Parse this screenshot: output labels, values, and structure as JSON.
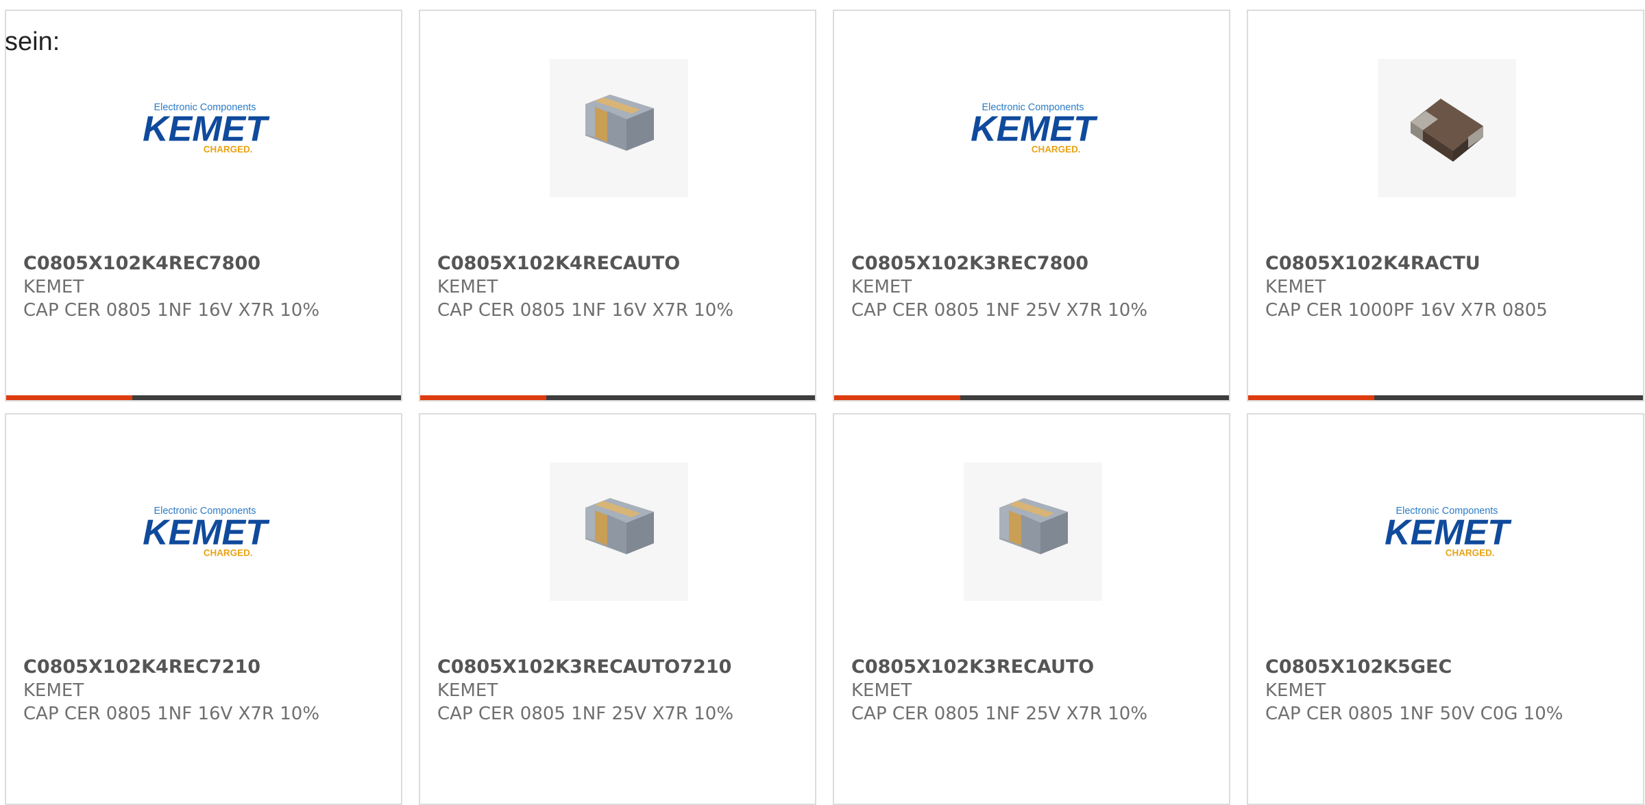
{
  "intro": "sein:",
  "brand": {
    "tagline": "Electronic Components",
    "name": "KEMET",
    "slogan": "CHARGED."
  },
  "colors": {
    "accent": "#dd3c0f",
    "bar_track": "#3d3d3d",
    "brand_blue": "#0f4a9c",
    "brand_gold": "#e8a317"
  },
  "cards": [
    {
      "part": "C0805X102K4REC7800",
      "mfr": "KEMET",
      "desc": "CAP CER 0805 1NF 16V X7R 10%",
      "image": "kemet-logo",
      "progress": 0.32
    },
    {
      "part": "C0805X102K4RECAUTO",
      "mfr": "KEMET",
      "desc": "CAP CER 0805 1NF 16V X7R 10%",
      "image": "capacitor-chip-gray",
      "progress": 0.32
    },
    {
      "part": "C0805X102K3REC7800",
      "mfr": "KEMET",
      "desc": "CAP CER 0805 1NF 25V X7R 10%",
      "image": "kemet-logo",
      "progress": 0.32
    },
    {
      "part": "C0805X102K4RACTU",
      "mfr": "KEMET",
      "desc": "CAP CER 1000PF 16V X7R 0805",
      "image": "capacitor-chip-brown",
      "progress": 0.32
    },
    {
      "part": "C0805X102K4REC7210",
      "mfr": "KEMET",
      "desc": "CAP CER 0805 1NF 16V X7R 10%",
      "image": "kemet-logo",
      "progress": null
    },
    {
      "part": "C0805X102K3RECAUTO7210",
      "mfr": "KEMET",
      "desc": "CAP CER 0805 1NF 25V X7R 10%",
      "image": "capacitor-chip-gray",
      "progress": null
    },
    {
      "part": "C0805X102K3RECAUTO",
      "mfr": "KEMET",
      "desc": "CAP CER 0805 1NF 25V X7R 10%",
      "image": "capacitor-chip-gray",
      "progress": null
    },
    {
      "part": "C0805X102K5GEC",
      "mfr": "KEMET",
      "desc": "CAP CER 0805 1NF 50V C0G 10%",
      "image": "kemet-logo",
      "progress": null
    }
  ]
}
